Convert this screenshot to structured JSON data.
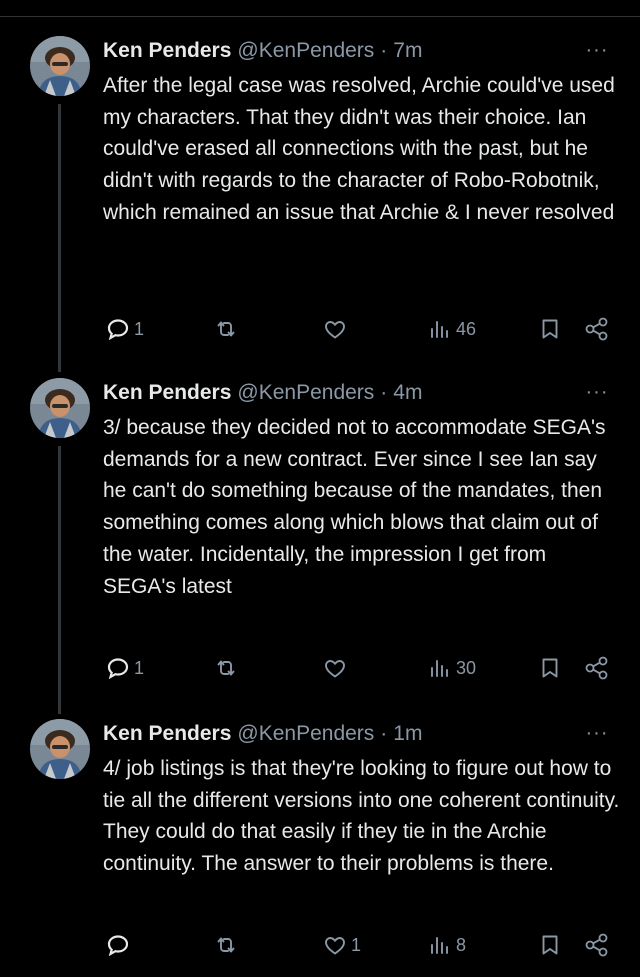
{
  "tweets": [
    {
      "name": "Ken Penders",
      "handle": "@KenPenders",
      "separator": "·",
      "time": "7m",
      "more": "···",
      "text": "After the legal case was resolved, Archie could've used my characters. That they didn't was their choice. Ian could've erased all connections with the past, but he didn't with regards to the character of Robo-Robotnik, which remained an issue that Archie & I never resolved",
      "reply_count": "1",
      "retweet_count": "",
      "like_count": "",
      "view_count": "46"
    },
    {
      "name": "Ken Penders",
      "handle": "@KenPenders",
      "separator": "·",
      "time": "4m",
      "more": "···",
      "text": "3/ because they decided not to accommodate SEGA's demands for a new contract. Ever since I see Ian say he can't do something because of the mandates, then something comes along which blows that claim out of the water. Incidentally, the impression I get from SEGA's latest",
      "reply_count": "1",
      "retweet_count": "",
      "like_count": "",
      "view_count": "30"
    },
    {
      "name": "Ken Penders",
      "handle": "@KenPenders",
      "separator": "·",
      "time": "1m",
      "more": "···",
      "text": "4/ job listings is that they're looking to figure out how to tie all the different versions into one coherent continuity. They could do that easily if they tie in the Archie continuity. The answer to their problems is there.",
      "reply_count": "",
      "retweet_count": "",
      "like_count": "1",
      "view_count": "8"
    }
  ],
  "icons": {
    "reply": "reply-icon",
    "retweet": "retweet-icon",
    "like": "like-icon",
    "views": "views-icon",
    "bookmark": "bookmark-icon",
    "share": "share-icon"
  },
  "colors": {
    "background": "#000000",
    "text": "#e7e9ea",
    "secondary": "#8b98a5",
    "thread_line": "#333639"
  }
}
